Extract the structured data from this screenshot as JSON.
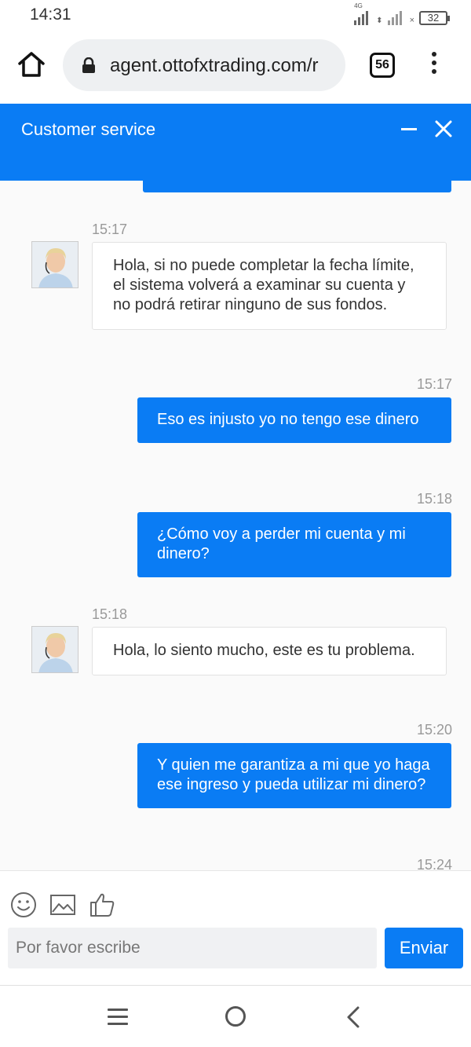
{
  "status_bar": {
    "time": "14:31",
    "network": "4G",
    "battery": "32"
  },
  "browser": {
    "url": "agent.ottofxtrading.com/r",
    "tab_count": "56"
  },
  "chat": {
    "title": "Customer service",
    "messages": [
      {
        "sender": "agent",
        "time": "15:17",
        "text": "Hola, si no puede completar la fecha límite, el sistema volverá a examinar su cuenta y no podrá retirar ninguno de sus fondos."
      },
      {
        "sender": "user",
        "time": "15:17",
        "text": "Eso es injusto yo no tengo ese dinero"
      },
      {
        "sender": "user",
        "time": "15:18",
        "text": "¿Cómo voy a perder mi cuenta y mi dinero?"
      },
      {
        "sender": "agent",
        "time": "15:18",
        "text": "Hola, lo siento mucho, este es tu problema."
      },
      {
        "sender": "user",
        "time": "15:20",
        "text": "Y quien me garantiza a mi que yo haga ese ingreso y pueda utilizar mi dinero?"
      },
      {
        "sender": "user",
        "time": "15:24",
        "text": ""
      }
    ]
  },
  "composer": {
    "placeholder": "Por favor escribe",
    "send_label": "Enviar",
    "tools": [
      "emoji-icon",
      "image-icon",
      "thumbs-up-icon"
    ]
  },
  "colors": {
    "accent": "#0a7cf4",
    "agent_bubble": "#ffffff",
    "timestamp": "#999999"
  }
}
